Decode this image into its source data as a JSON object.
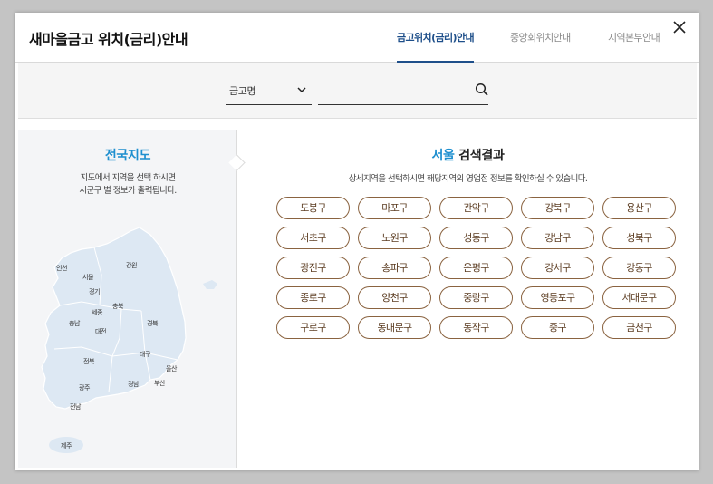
{
  "header": {
    "title": "새마을금고 위치(금리)안내",
    "tabs": [
      {
        "label": "금고위치(금리)안내",
        "active": true
      },
      {
        "label": "중앙회위치안내",
        "active": false
      },
      {
        "label": "지역본부안내",
        "active": false
      }
    ],
    "close_icon": "close-icon"
  },
  "search": {
    "select_value": "금고명",
    "input_value": "",
    "placeholder": "",
    "search_icon": "search-icon"
  },
  "map_panel": {
    "title": "전국지도",
    "desc_line1": "지도에서 지역을 선택 하시면",
    "desc_line2": "시군구 별 정보가 출력됩니다.",
    "regions": [
      "인천",
      "서울",
      "강원",
      "경기",
      "충북",
      "세종",
      "충남",
      "대전",
      "경북",
      "대구",
      "전북",
      "울산",
      "경남",
      "부산",
      "광주",
      "전남",
      "제주"
    ]
  },
  "results": {
    "city": "서울",
    "suffix": "검색결과",
    "desc": "상세지역을 선택하시면 해당지역의 영업점 정보를 확인하실 수 있습니다.",
    "districts": [
      "도봉구",
      "마포구",
      "관악구",
      "강북구",
      "용산구",
      "서초구",
      "노원구",
      "성동구",
      "강남구",
      "성북구",
      "광진구",
      "송파구",
      "은평구",
      "강서구",
      "강동구",
      "종로구",
      "양천구",
      "중랑구",
      "영등포구",
      "서대문구",
      "구로구",
      "동대문구",
      "동작구",
      "중구",
      "금천구"
    ]
  },
  "colors": {
    "accent_blue": "#1e8fcf",
    "tab_active": "#1e4f8a",
    "district_border": "#8a6340",
    "map_fill": "#dde8f3"
  }
}
